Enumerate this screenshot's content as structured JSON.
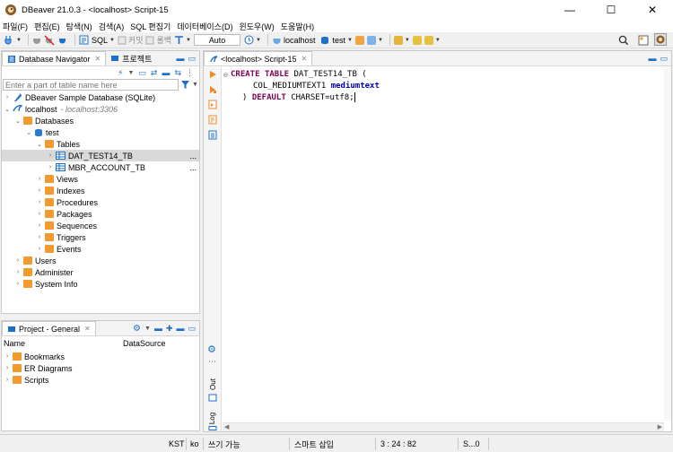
{
  "window": {
    "title": "DBeaver 21.0.3 - <localhost> Script-15",
    "minimize_glyph": "—",
    "maximize_glyph": "☐",
    "close_glyph": "✕"
  },
  "menu": [
    "파일(F)",
    "편집(E)",
    "탐색(N)",
    "검색(A)",
    "SQL 편집기",
    "데이터베이스(D)",
    "윈도우(W)",
    "도움말(H)"
  ],
  "toolbar": {
    "sql_label": "SQL",
    "commit_label": "커밋",
    "rollback_label": "롤백",
    "transaction_mode": "Auto",
    "connection": "localhost",
    "schema": "test"
  },
  "navigator": {
    "tab_label": "Database Navigator",
    "projects_tab_label": "프로젝트",
    "filter_placeholder": "Enter a part of table name here",
    "tree": {
      "sample_db": "DBeaver Sample Database (SQLite)",
      "localhost": "localhost",
      "localhost_hint": "- localhost:3306",
      "databases": "Databases",
      "test": "test",
      "tables": "Tables",
      "table1": "DAT_TEST14_TB",
      "table1_more": "...",
      "table2": "MBR_ACCOUNT_TB",
      "table2_more": "...",
      "views": "Views",
      "indexes": "Indexes",
      "procedures": "Procedures",
      "packages": "Packages",
      "sequences": "Sequences",
      "triggers": "Triggers",
      "events": "Events",
      "users": "Users",
      "administer": "Administer",
      "system_info": "System Info"
    }
  },
  "project": {
    "tab_label": "Project - General",
    "col_name": "Name",
    "col_datasource": "DataSource",
    "items": [
      "Bookmarks",
      "ER Diagrams",
      "Scripts"
    ]
  },
  "editor": {
    "tab_label": "<localhost> Script-15",
    "code": {
      "l1_kw1": "CREATE",
      "l1_kw2": "TABLE",
      "l1_rest": " DAT_TEST14_TB (",
      "l2_col": "COL_MEDIUMTEXT1",
      "l2_type": "mediumtext",
      "l3_open": ") ",
      "l3_kw": "DEFAULT",
      "l3_rest": " CHARSET=utf8;"
    },
    "side_labels": {
      "out": "Out",
      "log": "Log"
    }
  },
  "status": {
    "timezone": "KST",
    "locale": "ko",
    "write_mode": "쓰기 가능",
    "insert_mode": "스마트 삽입",
    "position": "3 : 24 : 82",
    "selection": "S...0"
  },
  "colors": {
    "accent_blue": "#1e6fc6",
    "folder_orange": "#f29a2e",
    "keyword": "#7f0055",
    "type_blue": "#0000c0"
  }
}
